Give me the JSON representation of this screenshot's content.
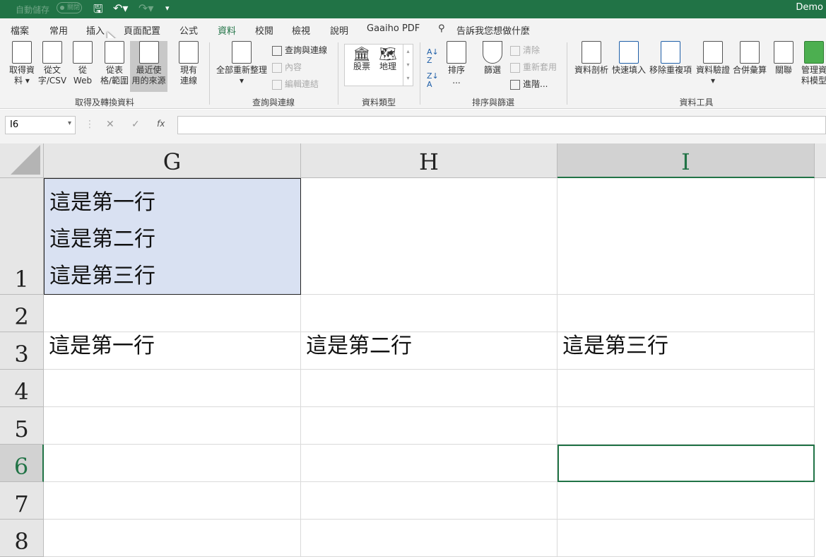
{
  "titlebar": {
    "autosave": "自動儲存",
    "autosave_state": "關閉",
    "doc": "Demo"
  },
  "tabs": [
    "檔案",
    "常用",
    "插入",
    "頁面配置",
    "公式",
    "資料",
    "校閱",
    "檢視",
    "說明",
    "Gaaiho PDF"
  ],
  "tell_me": "告訴我您想做什麼",
  "ribbon": {
    "get": {
      "label": "取得及轉換資料",
      "buttons": [
        "取得資\n料 ▾",
        "從文\n字/CSV",
        "從\nWeb",
        "從表\n格/範圍",
        "最近使\n用的來源",
        "現有\n連線"
      ]
    },
    "queries": {
      "label": "查詢與連線",
      "refresh": "全部重新整理",
      "small": [
        "查詢與連線",
        "內容",
        "編輯連結"
      ]
    },
    "types": {
      "label": "資料類型",
      "stock": "股票",
      "geo": "地理"
    },
    "sort": {
      "label": "排序與篩選",
      "sort": "排序\n...",
      "filter": "篩選",
      "small": [
        "清除",
        "重新套用",
        "進階..."
      ]
    },
    "tools": {
      "label": "資料工具",
      "buttons": [
        "資料剖析",
        "快速填入",
        "移除重複項",
        "資料驗證",
        "合併彙算",
        "關聯",
        "管理資\n料模型"
      ]
    }
  },
  "formula": {
    "namebox": "I6",
    "fx": "fx",
    "value": ""
  },
  "columns": [
    "G",
    "H",
    "I"
  ],
  "rows": [
    "1",
    "2",
    "3",
    "4",
    "5",
    "6",
    "7",
    "8"
  ],
  "cells": {
    "G1": "這是第一行\n這是第二行\n這是第三行",
    "G3": "這是第一行",
    "H3": "這是第二行",
    "I3": "這是第三行"
  }
}
